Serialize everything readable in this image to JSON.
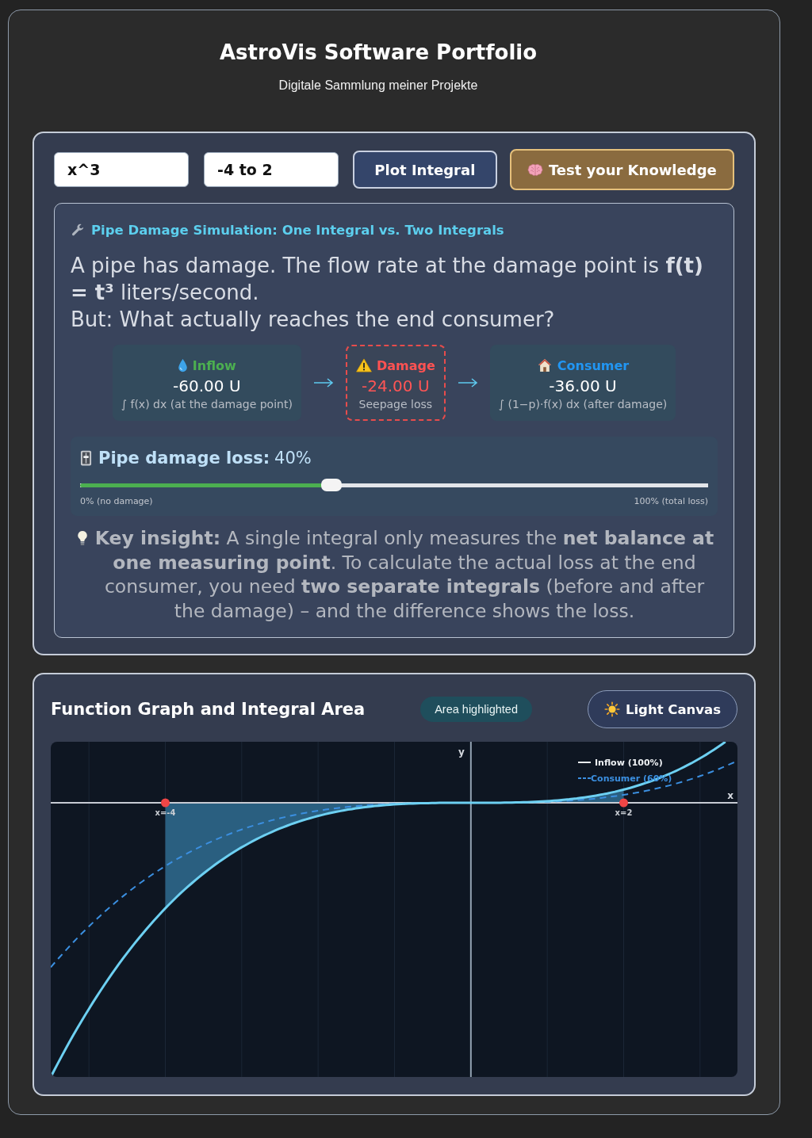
{
  "header": {
    "title": "AstroVis Software Portfolio",
    "subtitle": "Digitale Sammlung meiner Projekte"
  },
  "controls": {
    "function_field": {
      "value": "x^3"
    },
    "range_field": {
      "value": "-4 to 2"
    },
    "buttons": [
      {
        "kind": "primary",
        "label": "Plot Integral"
      },
      {
        "kind": "quiz",
        "label": "Test your Knowledge"
      }
    ]
  },
  "simulation": {
    "title": "Pipe Damage Simulation: One Integral vs. Two Integrals",
    "problem": "A pipe has damage. The flow rate at the damage point is **f(t) = t³** liters/second.",
    "question": "But: What actually reaches the end consumer?",
    "stages": [
      {
        "kind": "inflow",
        "label": "Inflow",
        "value": "-60.00 U",
        "note": "∫ f(x) dx (at the damage point)"
      },
      {
        "kind": "damage",
        "label": "Damage",
        "value": "-24.00 U",
        "note": "Seepage loss"
      },
      {
        "kind": "consumer",
        "label": "Consumer",
        "value": "-36.00 U",
        "note": "∫ (1−p)·f(x) dx (after damage)"
      }
    ],
    "slider": {
      "label": "Pipe damage loss:",
      "reading": "40%",
      "level": 0.4,
      "min_label": "0% (no damage)",
      "max_label": "100% (total loss)"
    },
    "insight": "**Key insight:** A single integral only measures the **net balance at one measuring point**. To calculate the actual loss at the end consumer, you need **two separate integrals** (before and after the damage) – and the difference shows the loss."
  },
  "graph": {
    "title": "Function Graph and Integral Area",
    "badge": "Area highlighted",
    "toggle": {
      "label": "Light Canvas"
    },
    "axis_labels": {
      "x": "x",
      "y": "y"
    },
    "bound_labels": [
      "x=-4",
      "x=2"
    ],
    "legend": [
      {
        "kind": "solid",
        "label": "Inflow (100%)"
      },
      {
        "kind": "dashed",
        "label": "Consumer (60%)"
      }
    ]
  }
}
